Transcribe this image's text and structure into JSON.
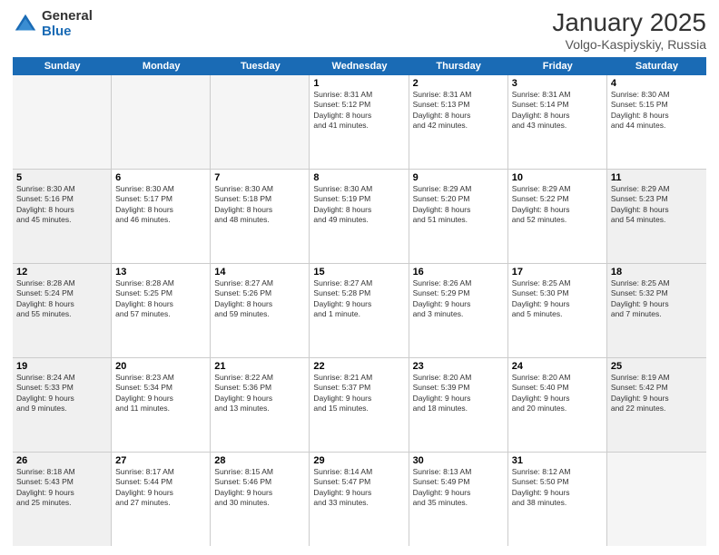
{
  "logo": {
    "general": "General",
    "blue": "Blue"
  },
  "title": "January 2025",
  "location": "Volgo-Kaspiyskiy, Russia",
  "days_of_week": [
    "Sunday",
    "Monday",
    "Tuesday",
    "Wednesday",
    "Thursday",
    "Friday",
    "Saturday"
  ],
  "weeks": [
    [
      {
        "day": "",
        "info": "",
        "shaded": true
      },
      {
        "day": "",
        "info": "",
        "shaded": true
      },
      {
        "day": "",
        "info": "",
        "shaded": true
      },
      {
        "day": "1",
        "info": "Sunrise: 8:31 AM\nSunset: 5:12 PM\nDaylight: 8 hours\nand 41 minutes."
      },
      {
        "day": "2",
        "info": "Sunrise: 8:31 AM\nSunset: 5:13 PM\nDaylight: 8 hours\nand 42 minutes."
      },
      {
        "day": "3",
        "info": "Sunrise: 8:31 AM\nSunset: 5:14 PM\nDaylight: 8 hours\nand 43 minutes."
      },
      {
        "day": "4",
        "info": "Sunrise: 8:30 AM\nSunset: 5:15 PM\nDaylight: 8 hours\nand 44 minutes."
      }
    ],
    [
      {
        "day": "5",
        "info": "Sunrise: 8:30 AM\nSunset: 5:16 PM\nDaylight: 8 hours\nand 45 minutes.",
        "shaded": true
      },
      {
        "day": "6",
        "info": "Sunrise: 8:30 AM\nSunset: 5:17 PM\nDaylight: 8 hours\nand 46 minutes."
      },
      {
        "day": "7",
        "info": "Sunrise: 8:30 AM\nSunset: 5:18 PM\nDaylight: 8 hours\nand 48 minutes."
      },
      {
        "day": "8",
        "info": "Sunrise: 8:30 AM\nSunset: 5:19 PM\nDaylight: 8 hours\nand 49 minutes."
      },
      {
        "day": "9",
        "info": "Sunrise: 8:29 AM\nSunset: 5:20 PM\nDaylight: 8 hours\nand 51 minutes."
      },
      {
        "day": "10",
        "info": "Sunrise: 8:29 AM\nSunset: 5:22 PM\nDaylight: 8 hours\nand 52 minutes."
      },
      {
        "day": "11",
        "info": "Sunrise: 8:29 AM\nSunset: 5:23 PM\nDaylight: 8 hours\nand 54 minutes.",
        "shaded": true
      }
    ],
    [
      {
        "day": "12",
        "info": "Sunrise: 8:28 AM\nSunset: 5:24 PM\nDaylight: 8 hours\nand 55 minutes.",
        "shaded": true
      },
      {
        "day": "13",
        "info": "Sunrise: 8:28 AM\nSunset: 5:25 PM\nDaylight: 8 hours\nand 57 minutes."
      },
      {
        "day": "14",
        "info": "Sunrise: 8:27 AM\nSunset: 5:26 PM\nDaylight: 8 hours\nand 59 minutes."
      },
      {
        "day": "15",
        "info": "Sunrise: 8:27 AM\nSunset: 5:28 PM\nDaylight: 9 hours\nand 1 minute."
      },
      {
        "day": "16",
        "info": "Sunrise: 8:26 AM\nSunset: 5:29 PM\nDaylight: 9 hours\nand 3 minutes."
      },
      {
        "day": "17",
        "info": "Sunrise: 8:25 AM\nSunset: 5:30 PM\nDaylight: 9 hours\nand 5 minutes."
      },
      {
        "day": "18",
        "info": "Sunrise: 8:25 AM\nSunset: 5:32 PM\nDaylight: 9 hours\nand 7 minutes.",
        "shaded": true
      }
    ],
    [
      {
        "day": "19",
        "info": "Sunrise: 8:24 AM\nSunset: 5:33 PM\nDaylight: 9 hours\nand 9 minutes.",
        "shaded": true
      },
      {
        "day": "20",
        "info": "Sunrise: 8:23 AM\nSunset: 5:34 PM\nDaylight: 9 hours\nand 11 minutes."
      },
      {
        "day": "21",
        "info": "Sunrise: 8:22 AM\nSunset: 5:36 PM\nDaylight: 9 hours\nand 13 minutes."
      },
      {
        "day": "22",
        "info": "Sunrise: 8:21 AM\nSunset: 5:37 PM\nDaylight: 9 hours\nand 15 minutes."
      },
      {
        "day": "23",
        "info": "Sunrise: 8:20 AM\nSunset: 5:39 PM\nDaylight: 9 hours\nand 18 minutes."
      },
      {
        "day": "24",
        "info": "Sunrise: 8:20 AM\nSunset: 5:40 PM\nDaylight: 9 hours\nand 20 minutes."
      },
      {
        "day": "25",
        "info": "Sunrise: 8:19 AM\nSunset: 5:42 PM\nDaylight: 9 hours\nand 22 minutes.",
        "shaded": true
      }
    ],
    [
      {
        "day": "26",
        "info": "Sunrise: 8:18 AM\nSunset: 5:43 PM\nDaylight: 9 hours\nand 25 minutes.",
        "shaded": true
      },
      {
        "day": "27",
        "info": "Sunrise: 8:17 AM\nSunset: 5:44 PM\nDaylight: 9 hours\nand 27 minutes."
      },
      {
        "day": "28",
        "info": "Sunrise: 8:15 AM\nSunset: 5:46 PM\nDaylight: 9 hours\nand 30 minutes."
      },
      {
        "day": "29",
        "info": "Sunrise: 8:14 AM\nSunset: 5:47 PM\nDaylight: 9 hours\nand 33 minutes."
      },
      {
        "day": "30",
        "info": "Sunrise: 8:13 AM\nSunset: 5:49 PM\nDaylight: 9 hours\nand 35 minutes."
      },
      {
        "day": "31",
        "info": "Sunrise: 8:12 AM\nSunset: 5:50 PM\nDaylight: 9 hours\nand 38 minutes."
      },
      {
        "day": "",
        "info": "",
        "shaded": true
      }
    ]
  ]
}
